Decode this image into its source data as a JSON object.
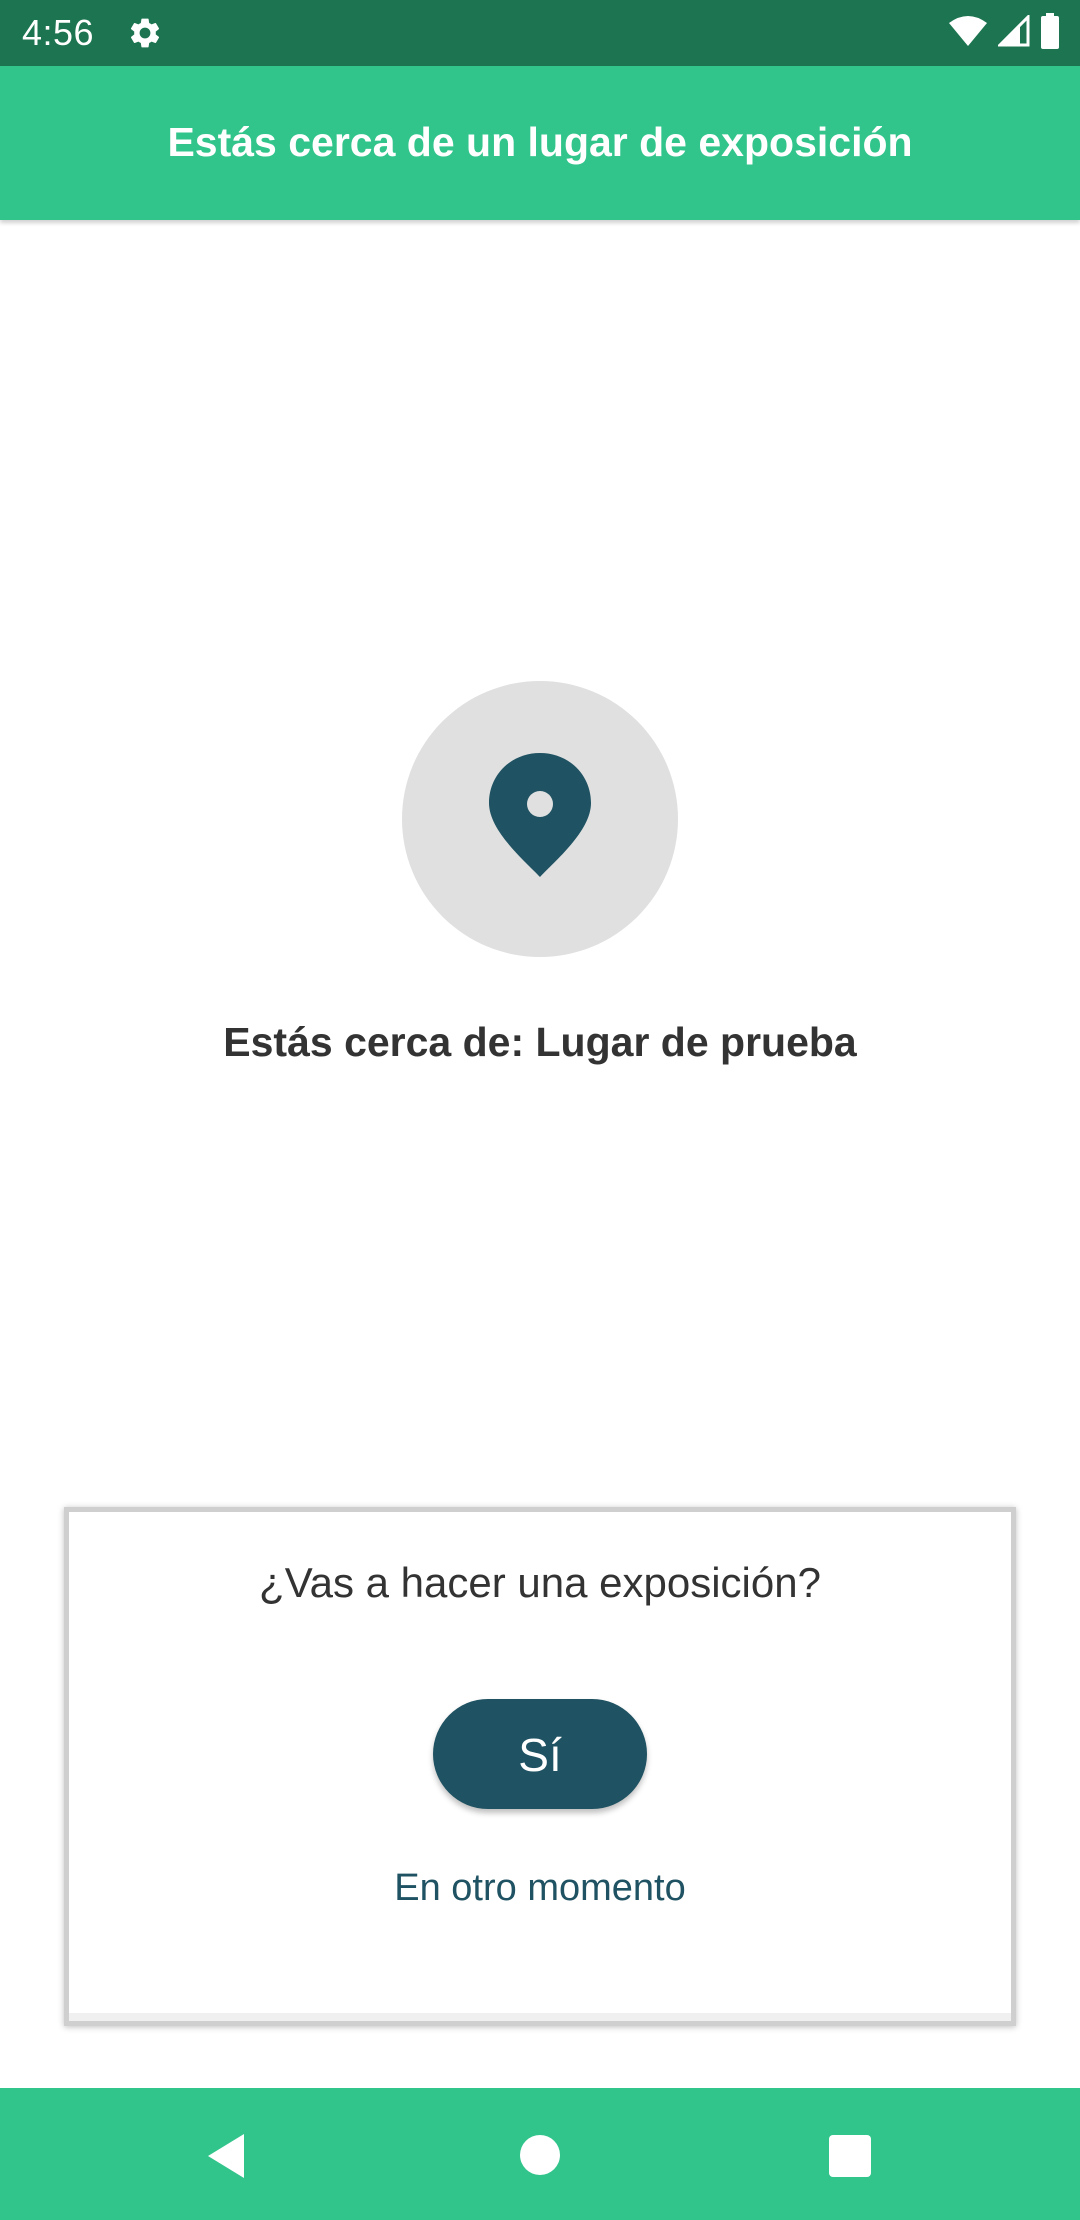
{
  "status_bar": {
    "time": "4:56",
    "icons": [
      "gear-icon",
      "wifi-icon",
      "signal-icon",
      "battery-icon"
    ]
  },
  "app_bar": {
    "title": "Estás cerca de un lugar de exposición"
  },
  "main": {
    "icon": "location-pin-icon",
    "near_text": "Estás cerca de: Lugar de prueba"
  },
  "card": {
    "question": "¿Vas a hacer una exposición?",
    "yes_label": "Sí",
    "later_label": "En otro momento"
  },
  "nav_bar": {
    "icons": [
      "back-icon",
      "home-icon",
      "recents-icon"
    ]
  },
  "colors": {
    "primary_green": "#31c48b",
    "status_green": "#1c7550",
    "accent_dark_teal": "#1f5262",
    "icon_circle_bg": "#e0e0e0"
  }
}
